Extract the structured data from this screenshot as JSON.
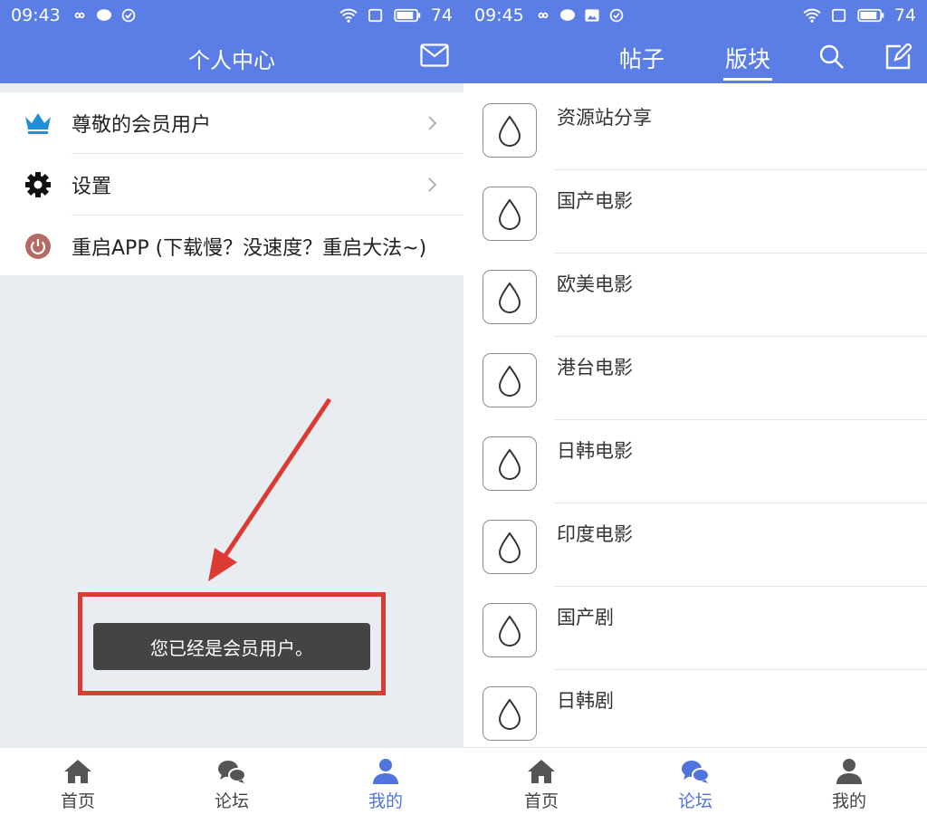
{
  "left": {
    "status": {
      "time": "09:43",
      "battery": "74"
    },
    "header": {
      "title": "个人中心",
      "icon": "mail-icon"
    },
    "menu": [
      {
        "label": "尊敬的会员用户",
        "icon": "crown-icon",
        "color": "#1f8fd6"
      },
      {
        "label": "设置",
        "icon": "gear-icon",
        "color": "#111111"
      },
      {
        "label": "重启APP (下载慢？没速度？重启大法~)",
        "icon": "power-icon",
        "color": "#b66a66"
      }
    ],
    "toast": "您已经是会员用户。",
    "annotation_color": "#de3a34",
    "tabbar": {
      "items": [
        "首页",
        "论坛",
        "我的"
      ],
      "active": "我的"
    }
  },
  "right": {
    "status": {
      "time": "09:45",
      "battery": "74"
    },
    "header": {
      "tabs": [
        "帖子",
        "版块"
      ],
      "active_tab": "版块",
      "icons": [
        "search-icon",
        "edit-icon"
      ]
    },
    "forums": [
      "资源站分享",
      "国产电影",
      "欧美电影",
      "港台电影",
      "日韩电影",
      "印度电影",
      "国产剧",
      "日韩剧"
    ],
    "tabbar": {
      "items": [
        "首页",
        "论坛",
        "我的"
      ],
      "active": "论坛"
    }
  },
  "colors": {
    "accent": "#5b7ee6",
    "tab_active": "#4f74dd"
  }
}
